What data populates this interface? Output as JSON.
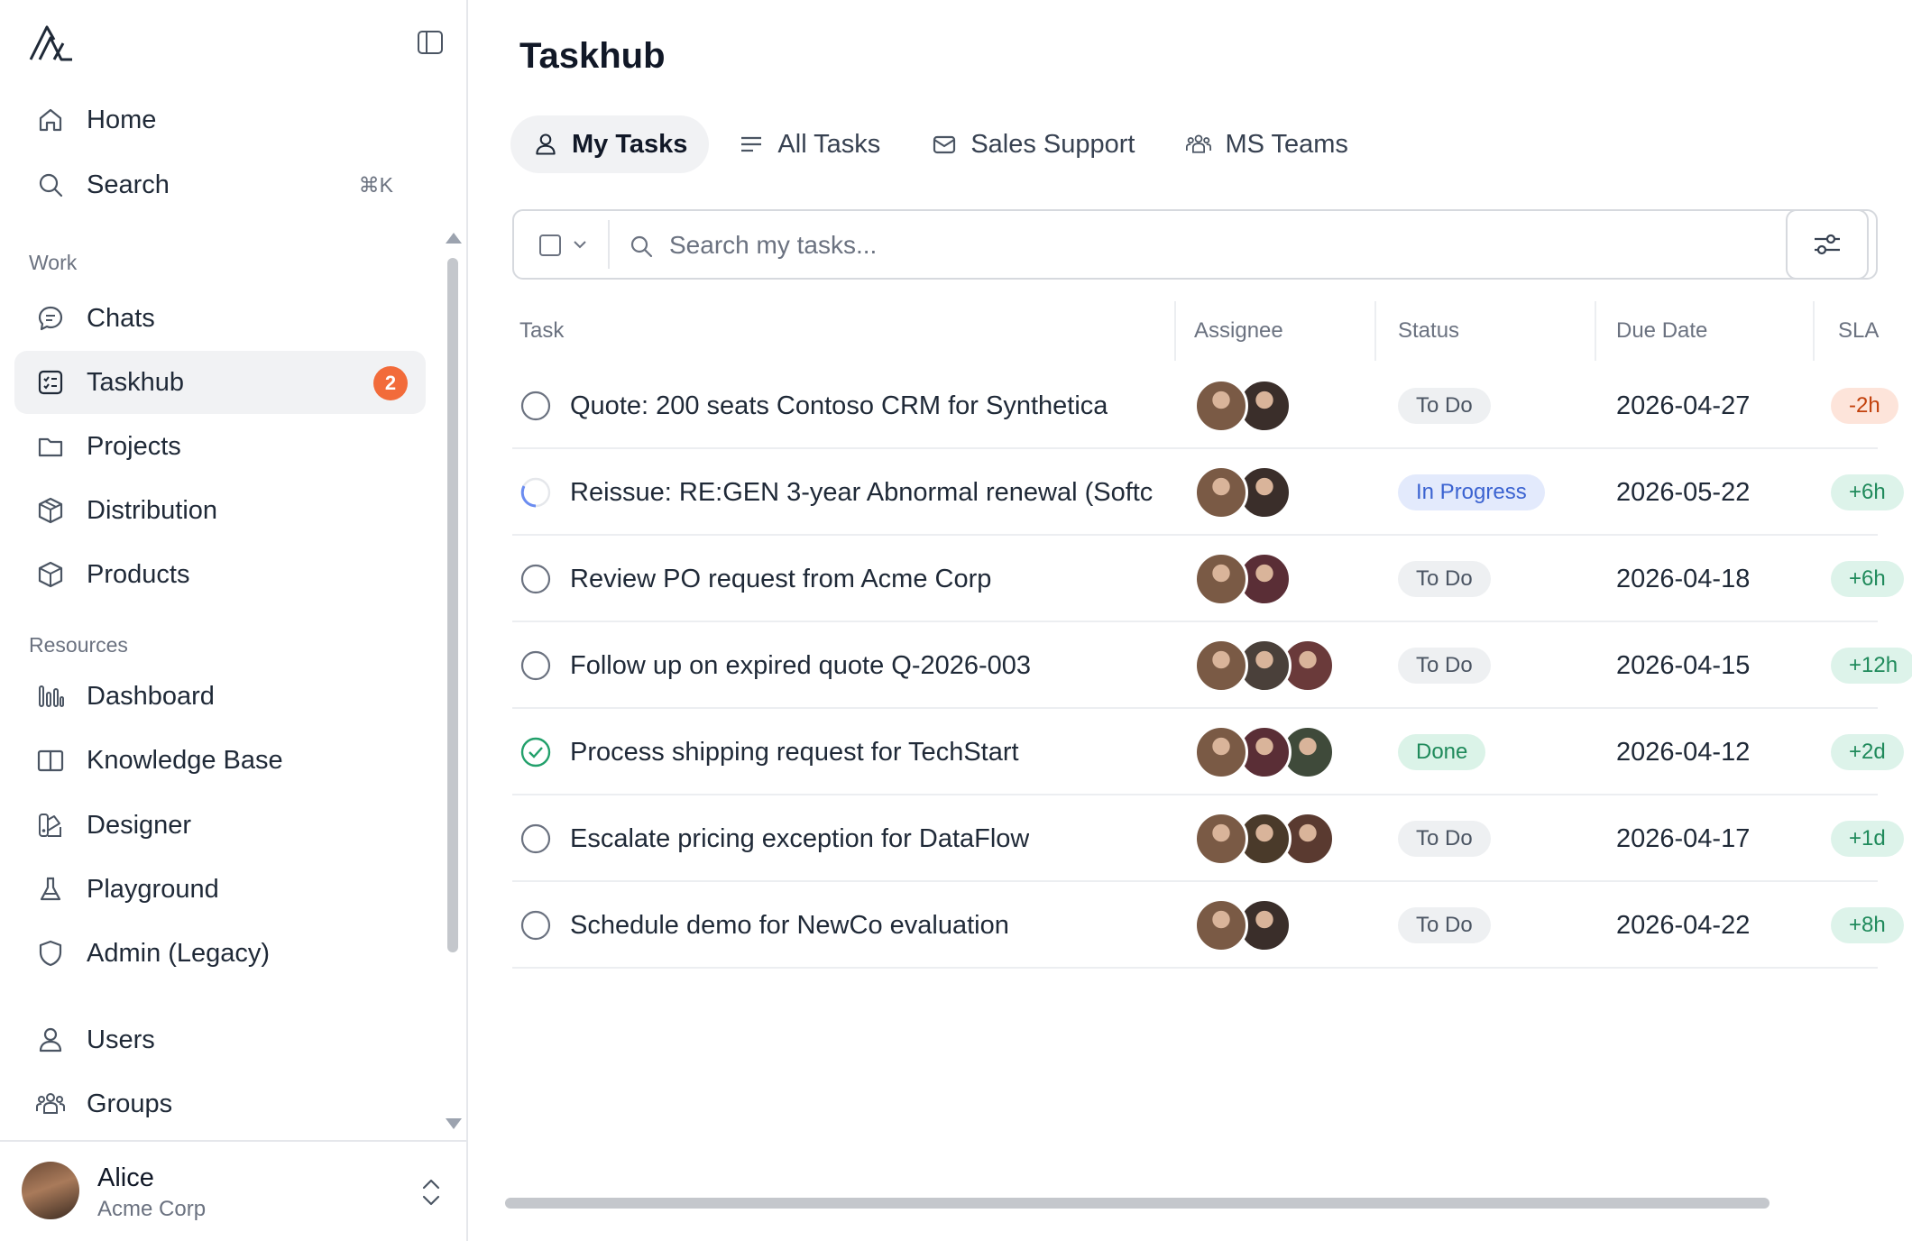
{
  "sidebar": {
    "logo": "app-logo",
    "nav_top": [
      {
        "label": "Home",
        "icon": "home-icon"
      },
      {
        "label": "Search",
        "icon": "search-icon",
        "shortcut": "⌘K"
      }
    ],
    "section_work": "Work",
    "work_items": [
      {
        "label": "Chats",
        "icon": "chat-icon"
      },
      {
        "label": "Taskhub",
        "icon": "task-list-icon",
        "badge": "2",
        "active": true
      },
      {
        "label": "Projects",
        "icon": "folder-icon"
      },
      {
        "label": "Distribution",
        "icon": "package-icon"
      },
      {
        "label": "Products",
        "icon": "box-icon"
      }
    ],
    "section_resources": "Resources",
    "resource_items": [
      {
        "label": "Dashboard",
        "icon": "bar-chart-icon"
      },
      {
        "label": "Knowledge Base",
        "icon": "book-icon"
      },
      {
        "label": "Designer",
        "icon": "designer-icon"
      },
      {
        "label": "Playground",
        "icon": "flask-icon"
      },
      {
        "label": "Admin (Legacy)",
        "icon": "shield-icon"
      }
    ],
    "admin_items": [
      {
        "label": "Users",
        "icon": "user-icon"
      },
      {
        "label": "Groups",
        "icon": "group-icon"
      }
    ],
    "user": {
      "name": "Alice",
      "org": "Acme Corp"
    }
  },
  "main": {
    "title": "Taskhub",
    "tabs": [
      {
        "label": "My Tasks",
        "icon": "user-icon",
        "active": true
      },
      {
        "label": "All Tasks",
        "icon": "list-icon"
      },
      {
        "label": "Sales Support",
        "icon": "mail-icon"
      },
      {
        "label": "MS Teams",
        "icon": "team-icon"
      }
    ],
    "search": {
      "placeholder": "Search my tasks..."
    },
    "columns": [
      "Task",
      "Assignee",
      "Status",
      "Due Date",
      "SLA"
    ],
    "rows": [
      {
        "task": "Quote: 200 seats Contoso CRM for Synthetica",
        "state": "todo",
        "assignees": [
          "#7a5a45",
          "#3a2e2a"
        ],
        "status": "To Do",
        "due": "2026-04-27",
        "sla": "-2h",
        "sla_kind": "neg"
      },
      {
        "task": "Reissue: RE:GEN 3-year Abnormal renewal (Softc",
        "state": "progress",
        "assignees": [
          "#7a5a45",
          "#3a2e2a"
        ],
        "status": "In Progress",
        "due": "2026-05-22",
        "sla": "+6h",
        "sla_kind": "pos"
      },
      {
        "task": "Review PO request from Acme Corp",
        "state": "todo",
        "assignees": [
          "#7a5a45",
          "#5a2e36"
        ],
        "status": "To Do",
        "due": "2026-04-18",
        "sla": "+6h",
        "sla_kind": "pos"
      },
      {
        "task": "Follow up on expired quote Q-2026-003",
        "state": "todo",
        "assignees": [
          "#7a5a45",
          "#4a403a",
          "#6a3a3a"
        ],
        "status": "To Do",
        "due": "2026-04-15",
        "sla": "+12h",
        "sla_kind": "pos"
      },
      {
        "task": "Process shipping request for TechStart",
        "state": "done",
        "assignees": [
          "#7a5a45",
          "#5a2e36",
          "#3f4a3a"
        ],
        "status": "Done",
        "due": "2026-04-12",
        "sla": "+2d",
        "sla_kind": "pos"
      },
      {
        "task": "Escalate pricing exception for DataFlow",
        "state": "todo",
        "assignees": [
          "#7a5a45",
          "#4a3a2a",
          "#5a3a30"
        ],
        "status": "To Do",
        "due": "2026-04-17",
        "sla": "+1d",
        "sla_kind": "pos"
      },
      {
        "task": "Schedule demo for NewCo evaluation",
        "state": "todo",
        "assignees": [
          "#7a5a45",
          "#3a2e2a"
        ],
        "status": "To Do",
        "due": "2026-04-22",
        "sla": "+8h",
        "sla_kind": "pos"
      }
    ]
  }
}
